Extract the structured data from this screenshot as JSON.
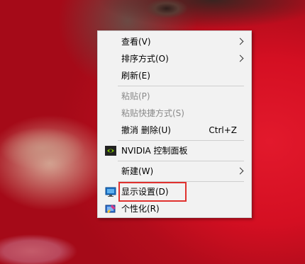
{
  "menu": {
    "items": [
      {
        "label": "查看(V)",
        "has_submenu": true
      },
      {
        "label": "排序方式(O)",
        "has_submenu": true
      },
      {
        "label": "刷新(E)"
      },
      {
        "label": "粘贴(P)",
        "disabled": true
      },
      {
        "label": "粘贴快捷方式(S)",
        "disabled": true
      },
      {
        "label": "撤消 删除(U)",
        "shortcut": "Ctrl+Z"
      },
      {
        "label": "NVIDIA 控制面板",
        "icon": "nvidia-icon"
      },
      {
        "label": "新建(W)",
        "has_submenu": true
      },
      {
        "label": "显示设置(D)",
        "icon": "display-icon",
        "highlighted": true
      },
      {
        "label": "个性化(R)",
        "icon": "personalize-icon"
      }
    ]
  },
  "colors": {
    "menu_background": "#f2f2f2",
    "highlight_border": "#e0312e",
    "disabled_text": "#8a8a8a"
  }
}
